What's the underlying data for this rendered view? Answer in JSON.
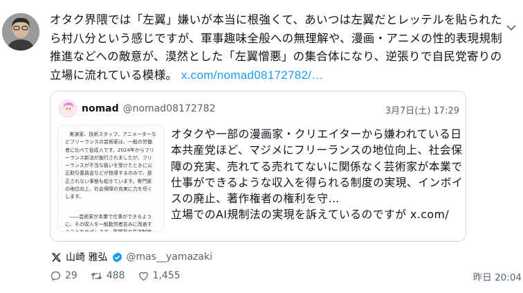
{
  "post": {
    "text": "オタク界隈では「左翼」嫌いが本当に根強くて、あいつは左翼だとレッテルを貼られたら村八分という感じですが、軍事趣味全般への無理解や、漫画・アニメの性的表現規制推進などへの敵意が、漠然とした「左翼憎悪」の集合体になり、逆張りで自民党寄りの立場に流れている模様。",
    "link": "x.com/nomad08172782/…"
  },
  "quoted": {
    "name": "nomad",
    "handle": "@nomad08172782",
    "date": "3月7日(土) 17:29",
    "text": "オタクや一部の漫画家・クリエイターから嫌われている日本共産党ほど、マジメにフリーランスの地位向上、社会保障の充実、売れてる売れてないに関係なく芸術家が本業で仕事ができるような収入を得られる制度の実現、インボイスの廃止、著作権者の権利を守…",
    "text_tail": "立場でのAI規制法の実現を訴えているのですが",
    "text_link": "x.com/",
    "image_para1": "実演家、技術スタッフ、アニメーターなどフリーランスの芸術家は、一般の労働者に比べて低収入です。2024年からフリーランス新法が施行されましたが、フリーランスが不当な扱いを受けたときに公正取引委員会などが指導するのみで、是正されない事態も起きています。専門家の地位向上、社会保障の充実に力を尽くします。",
    "image_para2": "――芸術家が本業で仕事ができるように、その収入を一般勤労者並みに改善することをめざします。専門家の共済制度の創設などを求めます。国保に加入するフリーランスの芸術家に対する保険料の減免を求めます。"
  },
  "author": {
    "name": "山崎 雅弘",
    "handle": "@mas__yamazaki"
  },
  "stats": {
    "replies": "29",
    "reposts": "488",
    "likes": "1,455"
  },
  "timestamp": "昨日 20:04",
  "icons": [
    "more-icon",
    "x-logo-icon",
    "verified-badge-icon",
    "reply-icon",
    "repost-icon",
    "like-icon"
  ],
  "colors": {
    "link": "#1d9bf0",
    "muted": "#536471",
    "border": "#cfd9de",
    "verified": "#1d9bf0"
  }
}
